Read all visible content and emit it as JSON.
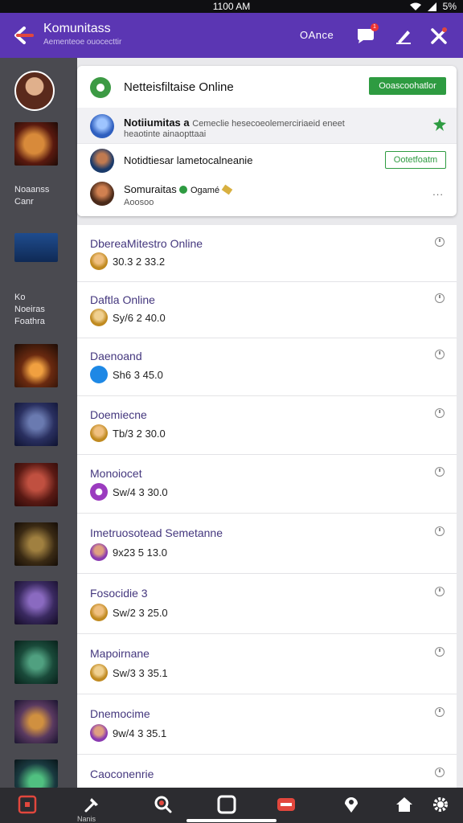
{
  "status_bar": {
    "time": "1100 AM",
    "battery": "5%"
  },
  "app_bar": {
    "title": "Komunitass",
    "subtitle": "Aementeoe ouocecttir",
    "action_label": "OAnce",
    "badge_count": "1"
  },
  "sidebar": {
    "label_1": "Noaanss Canr",
    "label_2": "Ko Noeiras Foathra"
  },
  "notifications_card": {
    "header_title": "Netteisfiltaise Online",
    "header_button": "Ooascoohatlor",
    "rows": [
      {
        "title": "Notiiumitas a",
        "text": "Cemeclie hesecoeolemerciriaeid eneet",
        "subtext": "heaotinte ainaopttaai"
      },
      {
        "title": "Notidtiesar lametocalneanie",
        "button": "Ootetfoatm"
      },
      {
        "title": "Somuraitas",
        "badge_text": "Ogamé",
        "subtext": "Aoosoo",
        "more": "..."
      }
    ]
  },
  "feed": [
    {
      "title": "DbereaMitestro Online",
      "meta": "30.3 2 33.2"
    },
    {
      "title": "Daftla Online",
      "meta": "Sy/6 2 40.0"
    },
    {
      "title": "Daenoand",
      "meta": "Sh6 3 45.0"
    },
    {
      "title": "Doemiecne",
      "meta": "Tb/3 2 30.0"
    },
    {
      "title": "Monoiocet",
      "meta": "Sw/4 3 30.0"
    },
    {
      "title": "Imetruosotead Semetanne",
      "meta": "9x23 5 13.0"
    },
    {
      "title": "Fosocidie 3",
      "meta": "Sw/2 3 25.0"
    },
    {
      "title": "Mapoirnane",
      "meta": "Sw/3 3 35.1"
    },
    {
      "title": "Dnemocime",
      "meta": "9w/4 3 35.1"
    },
    {
      "title": "Caoconenrie",
      "meta": ""
    }
  ],
  "nav": {
    "label": "Nanis"
  },
  "colors": {
    "brand": "#5b36b3",
    "accent_green": "#2e9b41",
    "sidebar": "#4a4a50",
    "feed_title": "#44377e"
  }
}
